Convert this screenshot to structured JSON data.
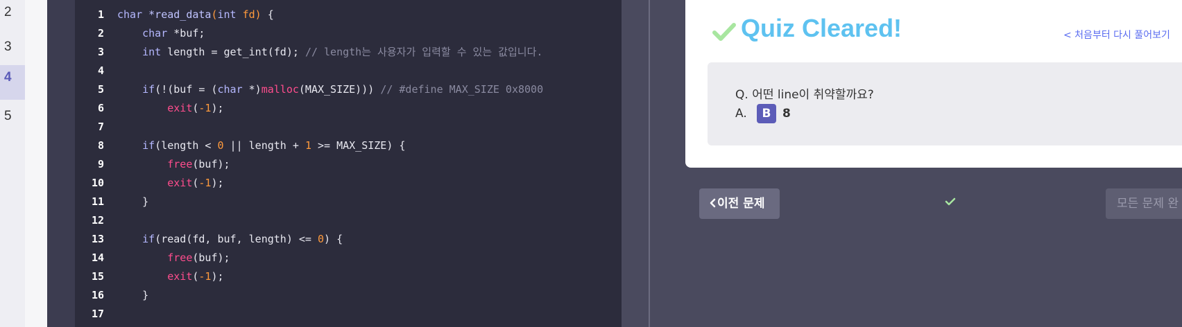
{
  "steps": [
    {
      "label": "2",
      "active": false
    },
    {
      "label": "3",
      "active": false
    },
    {
      "label": "4",
      "active": true
    },
    {
      "label": "5",
      "active": false
    }
  ],
  "code": {
    "lines": [
      {
        "n": "1",
        "tokens": [
          [
            "kw",
            "char "
          ],
          [
            "name",
            "*read_data"
          ],
          [
            "num",
            "("
          ],
          [
            "kw",
            "int "
          ],
          [
            "num",
            "fd) "
          ],
          [
            "txt",
            "{"
          ]
        ]
      },
      {
        "n": "2",
        "tokens": [
          [
            "txt",
            "    "
          ],
          [
            "kw",
            "char "
          ],
          [
            "txt",
            "*buf;"
          ]
        ]
      },
      {
        "n": "3",
        "tokens": [
          [
            "txt",
            "    "
          ],
          [
            "kw",
            "int "
          ],
          [
            "txt",
            "length = get_int(fd); "
          ],
          [
            "cm",
            "// length는 사용자가 입력할 수 있는 값입니다."
          ]
        ]
      },
      {
        "n": "4",
        "tokens": []
      },
      {
        "n": "5",
        "tokens": [
          [
            "txt",
            "    "
          ],
          [
            "kw",
            "if"
          ],
          [
            "txt",
            "(!(buf = ("
          ],
          [
            "kw",
            "char "
          ],
          [
            "txt",
            "*)"
          ],
          [
            "fn",
            "malloc"
          ],
          [
            "txt",
            "(MAX_SIZE))) "
          ],
          [
            "cm",
            "// #define MAX_SIZE 0x8000"
          ]
        ]
      },
      {
        "n": "6",
        "tokens": [
          [
            "txt",
            "        "
          ],
          [
            "fn",
            "exit"
          ],
          [
            "txt",
            "("
          ],
          [
            "num",
            "-1"
          ],
          [
            "txt",
            ");"
          ]
        ]
      },
      {
        "n": "7",
        "tokens": []
      },
      {
        "n": "8",
        "tokens": [
          [
            "txt",
            "    "
          ],
          [
            "kw",
            "if"
          ],
          [
            "txt",
            "(length < "
          ],
          [
            "num",
            "0"
          ],
          [
            "txt",
            " || length + "
          ],
          [
            "num",
            "1"
          ],
          [
            "txt",
            " >= MAX_SIZE) {"
          ]
        ]
      },
      {
        "n": "9",
        "tokens": [
          [
            "txt",
            "        "
          ],
          [
            "fn",
            "free"
          ],
          [
            "txt",
            "(buf);"
          ]
        ]
      },
      {
        "n": "10",
        "tokens": [
          [
            "txt",
            "        "
          ],
          [
            "fn",
            "exit"
          ],
          [
            "txt",
            "("
          ],
          [
            "num",
            "-1"
          ],
          [
            "txt",
            ");"
          ]
        ]
      },
      {
        "n": "11",
        "tokens": [
          [
            "txt",
            "    }"
          ]
        ]
      },
      {
        "n": "12",
        "tokens": []
      },
      {
        "n": "13",
        "tokens": [
          [
            "txt",
            "    "
          ],
          [
            "kw",
            "if"
          ],
          [
            "txt",
            "(read(fd, buf, length) <= "
          ],
          [
            "num",
            "0"
          ],
          [
            "txt",
            ") {"
          ]
        ]
      },
      {
        "n": "14",
        "tokens": [
          [
            "txt",
            "        "
          ],
          [
            "fn",
            "free"
          ],
          [
            "txt",
            "(buf);"
          ]
        ]
      },
      {
        "n": "15",
        "tokens": [
          [
            "txt",
            "        "
          ],
          [
            "fn",
            "exit"
          ],
          [
            "txt",
            "("
          ],
          [
            "num",
            "-1"
          ],
          [
            "txt",
            ");"
          ]
        ]
      },
      {
        "n": "16",
        "tokens": [
          [
            "txt",
            "    }"
          ]
        ]
      },
      {
        "n": "17",
        "tokens": []
      }
    ]
  },
  "result": {
    "title": "Quiz Cleared!",
    "restart_link": "< 처음부터 다시 풀어보기",
    "question": "Q. 어떤 line이 취약할까요?",
    "answer_prefix": "A.",
    "answer_badge": "B",
    "answer_value": "8"
  },
  "nav": {
    "prev_label": "이전 문제",
    "complete_label": "모든 문제 완"
  },
  "colors": {
    "accent_title": "#5ec2f0",
    "check_green": "#a8e6a0",
    "badge": "#5c5cb8"
  },
  "icons": {
    "check": "check-icon",
    "prev": "chevron-left-icon"
  }
}
